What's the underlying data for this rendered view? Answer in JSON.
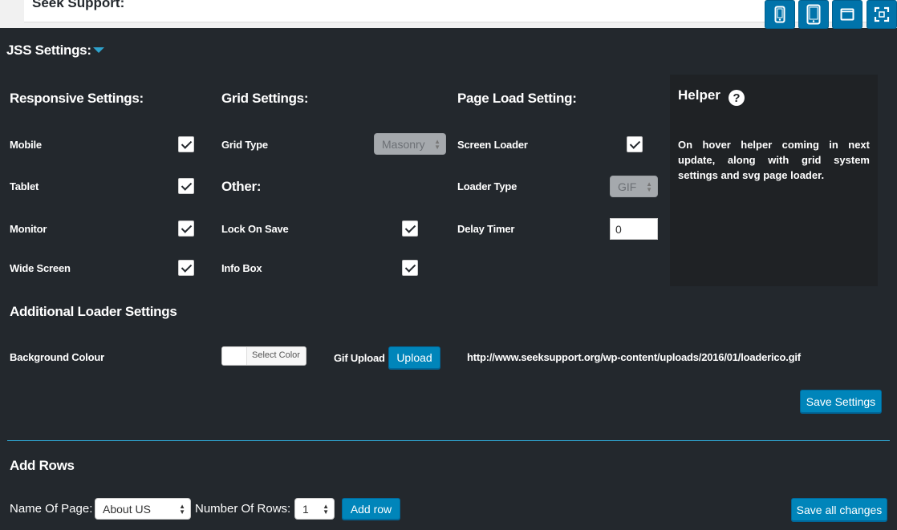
{
  "topbar": {
    "title": "Seek Support:"
  },
  "device_buttons": [
    {
      "name": "mobile",
      "icon": "mobile-icon"
    },
    {
      "name": "tablet",
      "icon": "tablet-icon"
    },
    {
      "name": "monitor",
      "icon": "monitor-icon"
    },
    {
      "name": "widescreen",
      "icon": "fullscreen-icon"
    }
  ],
  "settings": {
    "title": "JSS Settings:",
    "responsive": {
      "heading": "Responsive Settings:",
      "items": [
        {
          "label": "Mobile",
          "checked": true
        },
        {
          "label": "Tablet",
          "checked": true
        },
        {
          "label": "Monitor",
          "checked": true
        },
        {
          "label": "Wide Screen",
          "checked": true
        }
      ]
    },
    "grid": {
      "heading": "Grid Settings:",
      "type_label": "Grid Type",
      "type_value": "Masonry"
    },
    "other": {
      "heading": "Other:",
      "items": [
        {
          "label": "Lock On Save",
          "checked": true
        },
        {
          "label": "Info Box",
          "checked": true
        }
      ]
    },
    "page_load": {
      "heading": "Page Load Setting:",
      "screen_loader_label": "Screen Loader",
      "screen_loader_checked": true,
      "loader_type_label": "Loader Type",
      "loader_type_value": "GIF",
      "delay_label": "Delay Timer",
      "delay_value": "0"
    },
    "helper": {
      "title": "Helper",
      "icon_glyph": "?",
      "body": "On hover helper coming in next update, along with grid system settings and svg page loader."
    },
    "additional": {
      "heading": "Additional Loader Settings",
      "bg_label": "Background Colour",
      "select_color": "Select Color",
      "gif_label": "Gif Upload",
      "upload_label": "Upload",
      "gif_url": "http://www.seeksupport.org/wp-content/uploads/2016/01/loaderico.gif"
    },
    "save_label": "Save Settings"
  },
  "add_rows": {
    "heading": "Add Rows",
    "page_label": "Name Of Page:",
    "page_value": "About US",
    "rows_label": "Number Of Rows:",
    "rows_value": "1",
    "add_label": "Add row",
    "save_all_label": "Save all changes"
  },
  "colors": {
    "background": "#23282d",
    "accent": "#0085ba",
    "divider": "#2ea2cc",
    "helper_bg": "#1f2225"
  }
}
